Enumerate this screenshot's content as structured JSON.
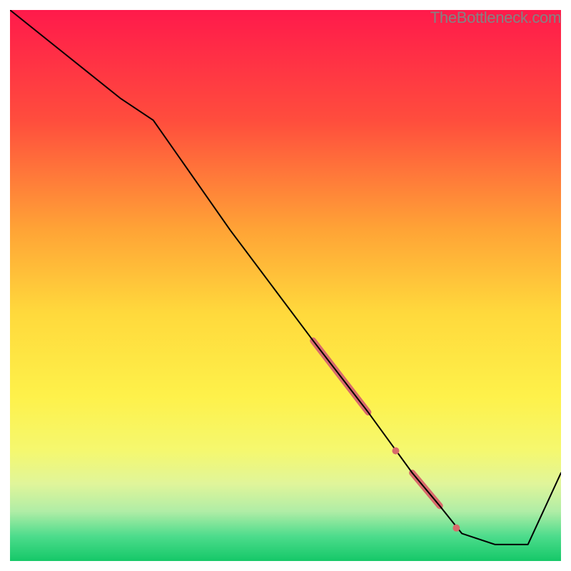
{
  "watermark": "TheBottleneck.com",
  "chart_data": {
    "type": "line",
    "title": "",
    "xlabel": "",
    "ylabel": "",
    "xlim": [
      0,
      100
    ],
    "ylim": [
      0,
      100
    ],
    "gradient_stops": [
      {
        "offset": 0,
        "color": "#ff1a4b"
      },
      {
        "offset": 20,
        "color": "#ff4d3d"
      },
      {
        "offset": 40,
        "color": "#ffa436"
      },
      {
        "offset": 55,
        "color": "#ffd93c"
      },
      {
        "offset": 70,
        "color": "#fef14a"
      },
      {
        "offset": 80,
        "color": "#f5f86f"
      },
      {
        "offset": 86,
        "color": "#e0f59a"
      },
      {
        "offset": 91,
        "color": "#b0eda6"
      },
      {
        "offset": 95.5,
        "color": "#4ddc8c"
      },
      {
        "offset": 100,
        "color": "#15c868"
      }
    ],
    "series": [
      {
        "name": "bottleneck-curve",
        "x": [
          0,
          10,
          20,
          26,
          40,
          55,
          65,
          73,
          78,
          82,
          88,
          94,
          100
        ],
        "y": [
          100,
          92,
          84,
          80,
          60,
          40,
          27,
          16,
          10,
          5,
          3,
          3,
          16
        ]
      }
    ],
    "highlight_segments": [
      {
        "x0": 55,
        "y0": 40,
        "x1": 65,
        "y1": 27,
        "width": 9
      },
      {
        "x0": 73,
        "y0": 16,
        "x1": 78,
        "y1": 10,
        "width": 9
      }
    ],
    "highlight_dots": [
      {
        "x": 70,
        "y": 20,
        "r": 5
      },
      {
        "x": 81,
        "y": 6,
        "r": 5
      }
    ],
    "highlight_color": "#d86b6b"
  }
}
